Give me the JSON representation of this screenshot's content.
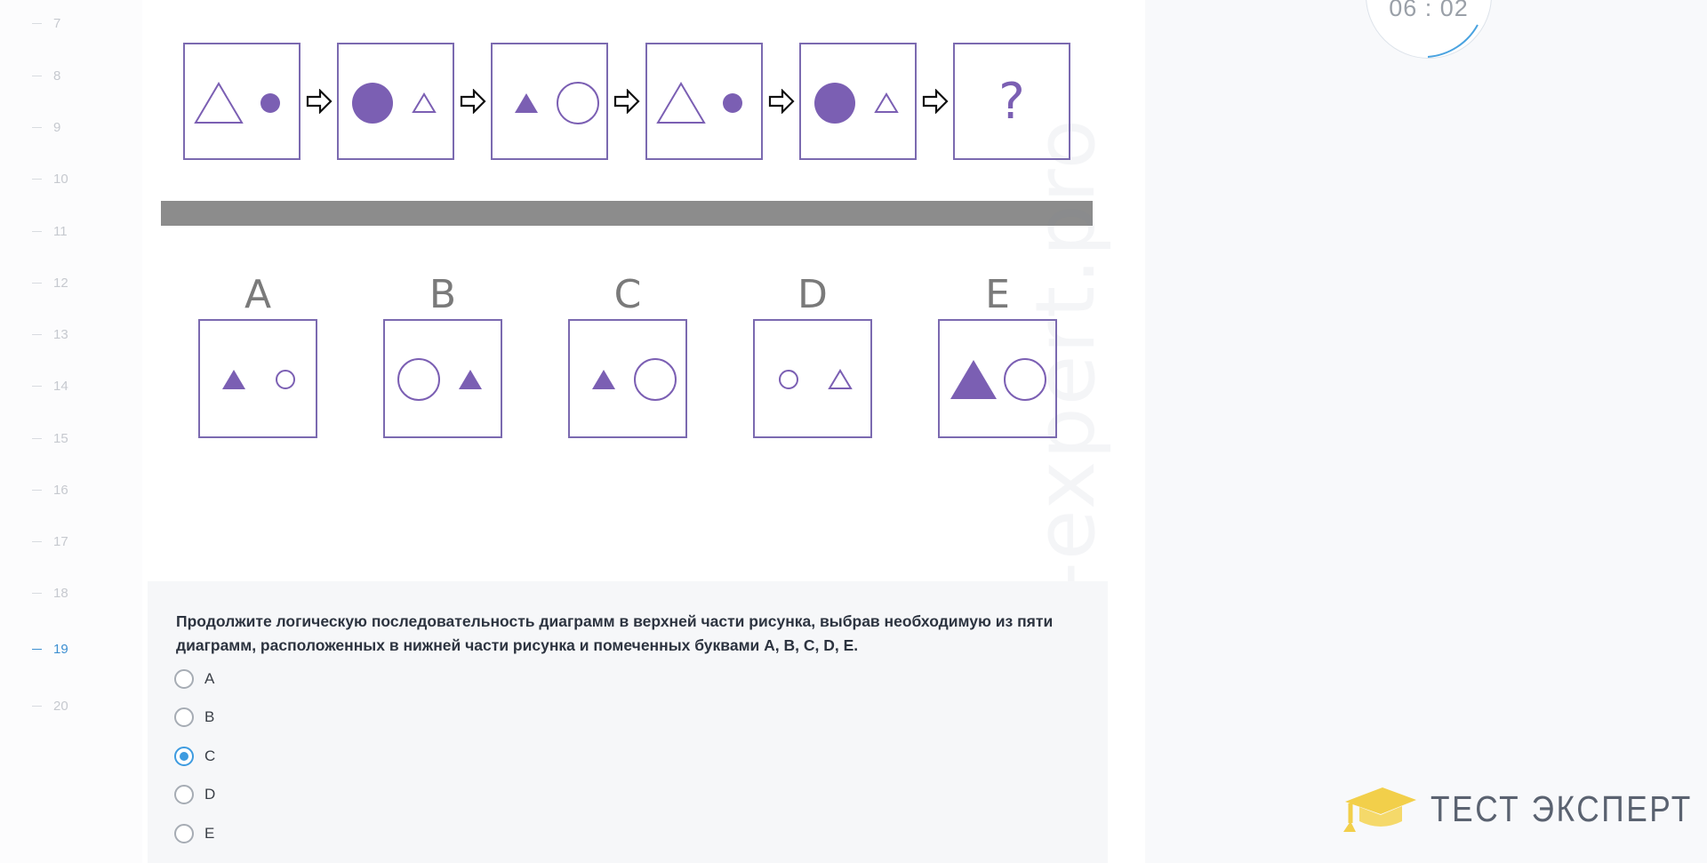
{
  "rail": {
    "items": [
      "7",
      "8",
      "9",
      "10",
      "11",
      "12",
      "13",
      "14",
      "15",
      "16",
      "17",
      "18",
      "19",
      "20"
    ],
    "active": "19"
  },
  "timer": {
    "text": "06 : 02"
  },
  "figure": {
    "sequence": [
      {
        "left": {
          "shape": "triangle",
          "fill": "outline",
          "size": "large"
        },
        "right": {
          "shape": "circle",
          "fill": "filled",
          "size": "small"
        }
      },
      {
        "left": {
          "shape": "circle",
          "fill": "filled",
          "size": "large"
        },
        "right": {
          "shape": "triangle",
          "fill": "outline",
          "size": "small"
        }
      },
      {
        "left": {
          "shape": "triangle",
          "fill": "filled",
          "size": "small"
        },
        "right": {
          "shape": "circle",
          "fill": "outline",
          "size": "large"
        }
      },
      {
        "left": {
          "shape": "triangle",
          "fill": "outline",
          "size": "large"
        },
        "right": {
          "shape": "circle",
          "fill": "filled",
          "size": "small"
        }
      },
      {
        "left": {
          "shape": "circle",
          "fill": "filled",
          "size": "large"
        },
        "right": {
          "shape": "triangle",
          "fill": "outline",
          "size": "small"
        }
      },
      {
        "question": "?"
      }
    ],
    "options": [
      {
        "letter": "A",
        "left": {
          "shape": "triangle",
          "fill": "filled",
          "size": "small"
        },
        "right": {
          "shape": "circle",
          "fill": "outline",
          "size": "small"
        }
      },
      {
        "letter": "B",
        "left": {
          "shape": "circle",
          "fill": "outline",
          "size": "large"
        },
        "right": {
          "shape": "triangle",
          "fill": "filled",
          "size": "small"
        }
      },
      {
        "letter": "C",
        "left": {
          "shape": "triangle",
          "fill": "filled",
          "size": "small"
        },
        "right": {
          "shape": "circle",
          "fill": "outline",
          "size": "large"
        }
      },
      {
        "letter": "D",
        "left": {
          "shape": "circle",
          "fill": "outline",
          "size": "small"
        },
        "right": {
          "shape": "triangle",
          "fill": "outline",
          "size": "small"
        }
      },
      {
        "letter": "E",
        "left": {
          "shape": "triangle",
          "fill": "filled",
          "size": "large"
        },
        "right": {
          "shape": "circle",
          "fill": "outline",
          "size": "large"
        }
      }
    ],
    "colors": {
      "shape": "#7b5fb3",
      "border": "#7b6ab0",
      "divider": "#8c8c8c"
    }
  },
  "watermark": "test-expert.pro",
  "question": {
    "text": "Продолжите логическую последовательность диаграмм в верхней части рисунка, выбрав необходимую из пяти диаграмм, расположенных в нижней части рисунка и помеченных буквами A, B, C, D, E.",
    "options": [
      "A",
      "B",
      "C",
      "D",
      "E"
    ],
    "selected": "C"
  },
  "logo": {
    "text": "ТЕСТ ЭКСПЕРТ",
    "icon": "graduation-cap-icon",
    "color": "#f2cf4a"
  }
}
